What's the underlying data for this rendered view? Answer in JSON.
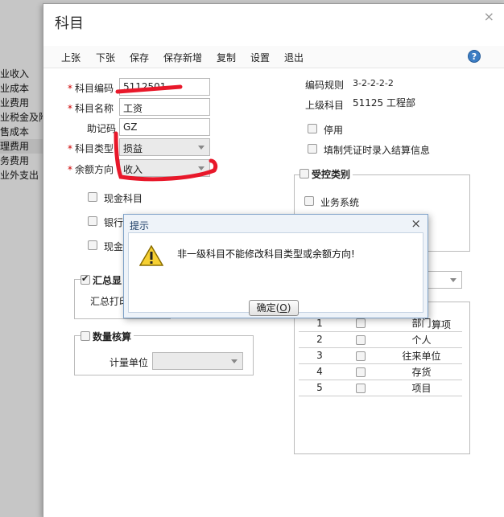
{
  "background_menu": [
    "业收入",
    "业成本",
    "业费用",
    "业税金及附",
    "售成本",
    "理费用",
    "务费用",
    "业外支出"
  ],
  "window": {
    "title": "科目",
    "close_glyph": "×",
    "toolbar": [
      "上张",
      "下张",
      "保存",
      "保存新增",
      "复制",
      "设置",
      "退出"
    ],
    "help_glyph": "?"
  },
  "form": {
    "code_label": "科目编码",
    "code_value": "5112501",
    "name_label": "科目名称",
    "name_value": "工资",
    "mnemonic_label": "助记码",
    "mnemonic_value": "GZ",
    "type_label": "科目类型",
    "type_value": "损益",
    "direction_label": "余额方向",
    "direction_value": "收入",
    "cash_subject": "现金科目",
    "bank_partial": "银行",
    "cash_partial": "现金",
    "summary_legend": "汇总显",
    "summary_print": "汇总打印",
    "quantity_legend": "数量核算",
    "unit_label": "计量单位"
  },
  "right": {
    "rule_label": "编码规则",
    "rule_value": "3-2-2-2-2",
    "parent_label": "上级科目",
    "parent_value": "51125 工程部",
    "disable_label": "停用",
    "settle_label": "填制凭证时录入结算信息",
    "controlled_legend": "受控类别",
    "business_system": "业务系统",
    "aux_header_partial": "算项",
    "aux_rows": [
      {
        "no": "1",
        "name": "部门"
      },
      {
        "no": "2",
        "name": "个人"
      },
      {
        "no": "3",
        "name": "往来单位"
      },
      {
        "no": "4",
        "name": "存货"
      },
      {
        "no": "5",
        "name": "项目"
      }
    ]
  },
  "dialog": {
    "title": "提示",
    "close_glyph": "×",
    "message": "非一级科目不能修改科目类型或余额方向!",
    "ok_prefix": "确定(",
    "ok_key": "O",
    "ok_suffix": ")"
  },
  "colors": {
    "annotation": "#e8182a",
    "dialog_border": "#7fa2c8",
    "required": "#cc0000"
  }
}
